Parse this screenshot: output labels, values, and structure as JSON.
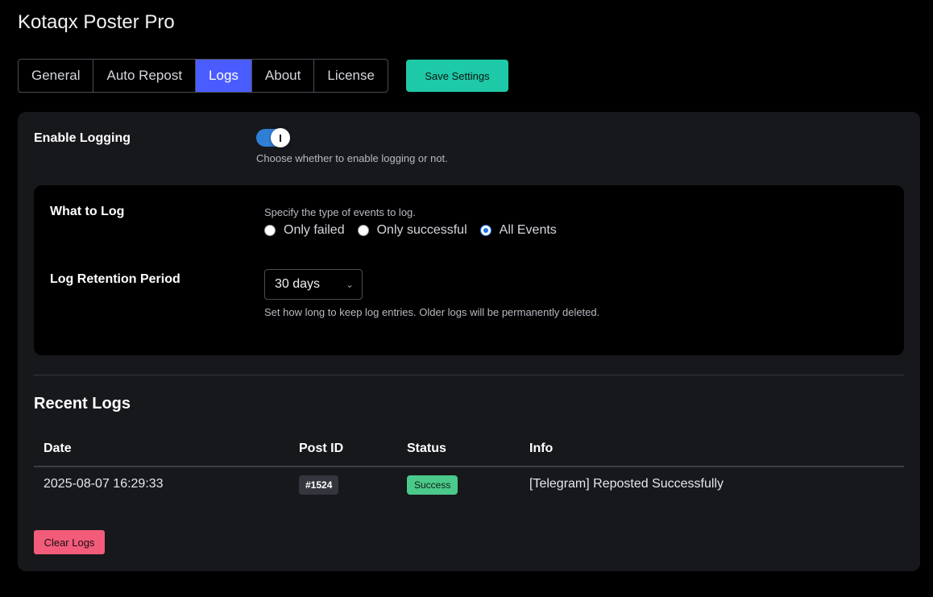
{
  "app": {
    "title": "Kotaqx Poster Pro"
  },
  "tabs": [
    {
      "label": "General"
    },
    {
      "label": "Auto Repost"
    },
    {
      "label": "Logs",
      "active": true
    },
    {
      "label": "About"
    },
    {
      "label": "License"
    }
  ],
  "toolbar": {
    "save_label": "Save Settings"
  },
  "logging": {
    "label": "Enable Logging",
    "enabled": true,
    "description": "Choose whether to enable logging or not."
  },
  "what_to_log": {
    "label": "What to Log",
    "description": "Specify the type of events to log.",
    "options": [
      {
        "label": "Only failed",
        "checked": false
      },
      {
        "label": "Only successful",
        "checked": false
      },
      {
        "label": "All Events",
        "checked": true
      }
    ]
  },
  "retention": {
    "label": "Log Retention Period",
    "selected": "30 days",
    "description": "Set how long to keep log entries. Older logs will be permanently deleted."
  },
  "recent_logs": {
    "title": "Recent Logs",
    "columns": [
      "Date",
      "Post ID",
      "Status",
      "Info"
    ],
    "rows": [
      {
        "date": "2025-08-07 16:29:33",
        "post_id": "#1524",
        "status": "Success",
        "info": "[Telegram] Reposted Successfully"
      }
    ]
  },
  "clear_label": "Clear Logs",
  "colors": {
    "accent": "#4b5cff",
    "save": "#1ec9a8",
    "success": "#4bc98a",
    "danger": "#f25c7a",
    "toggle": "#2f7fd6"
  }
}
